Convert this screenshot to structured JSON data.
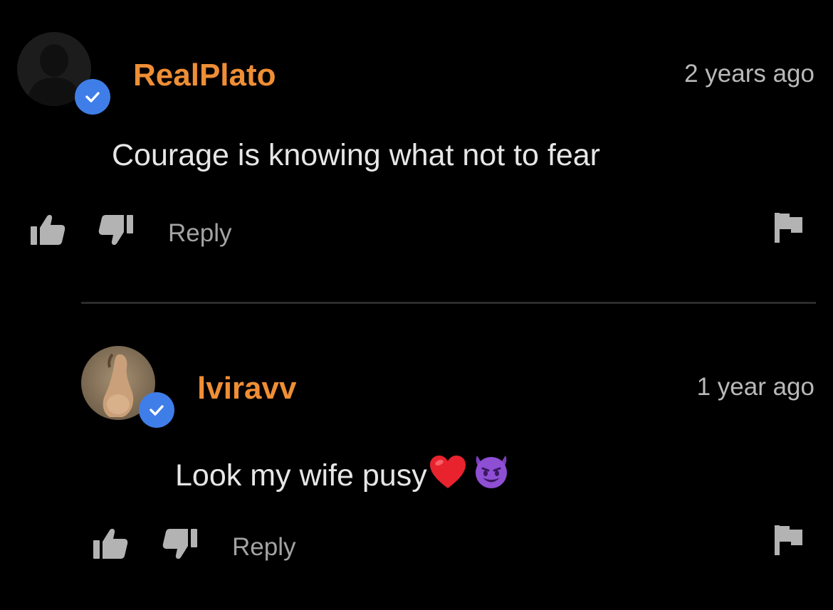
{
  "comments": [
    {
      "username": "RealPlato",
      "timestamp": "2 years ago",
      "text": "Courage is knowing what not to fear",
      "emojis": [],
      "reply_label": "Reply"
    },
    {
      "username": "lviravv",
      "timestamp": "1 year ago",
      "text": "Look my wife pusy",
      "emojis": [
        "red-heart",
        "smiling-face-with-horns"
      ],
      "reply_label": "Reply"
    }
  ],
  "colors": {
    "background": "#000000",
    "username": "#ef8e35",
    "verified_badge": "#3f7ee8",
    "text": "#e6e6e6",
    "muted": "#a3a3a3"
  }
}
